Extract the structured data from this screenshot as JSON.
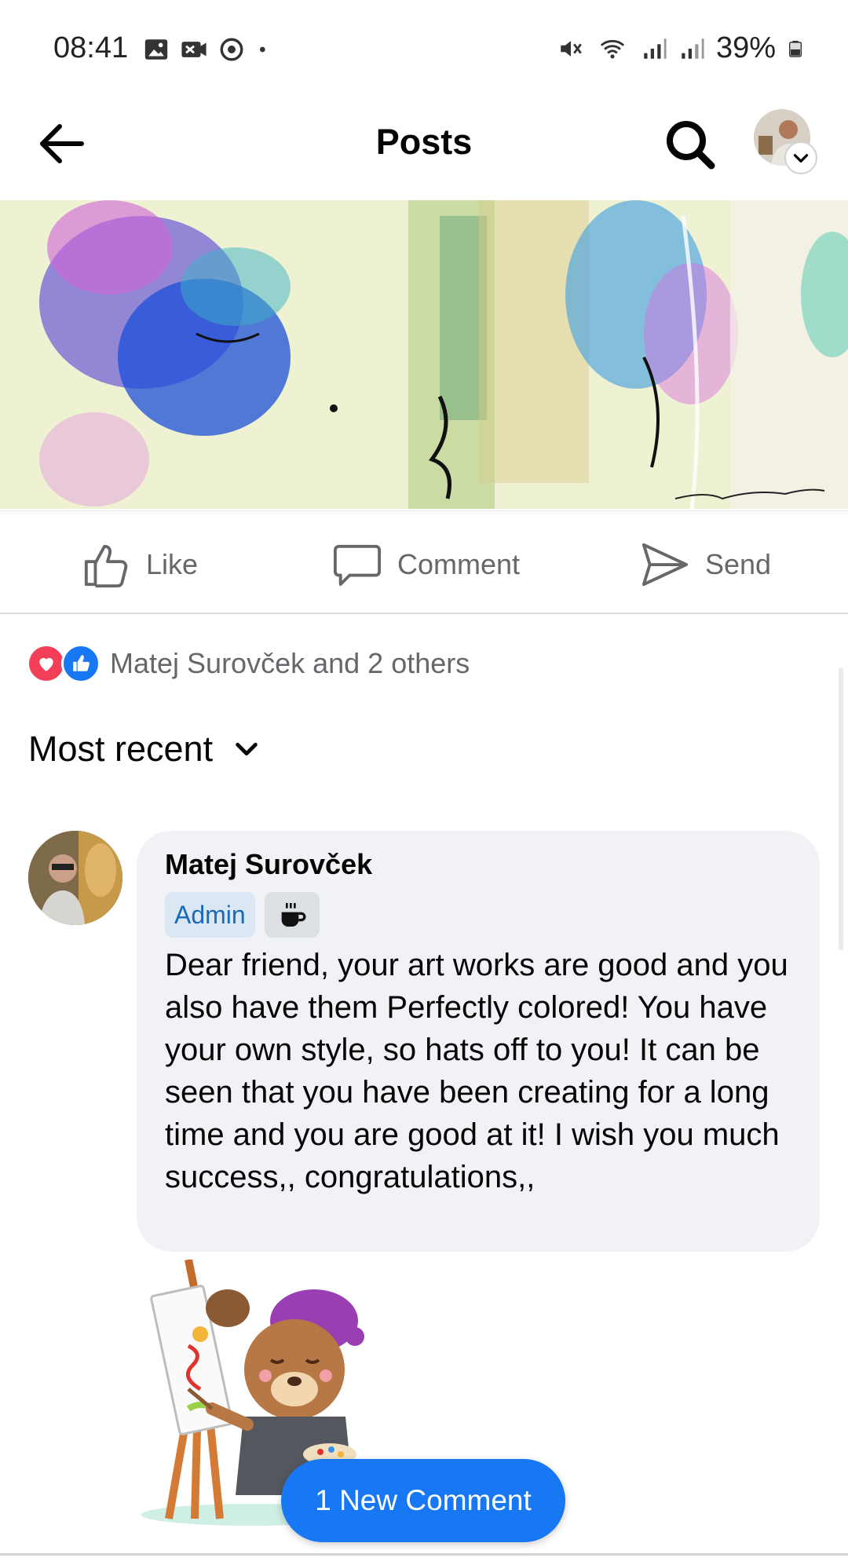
{
  "status_bar": {
    "time": "08:41",
    "battery_percent": "39%",
    "left_icons": [
      "gallery-icon",
      "media-icon",
      "sync-icon",
      "dot-icon"
    ],
    "right_icons": [
      "mute-icon",
      "wifi-icon",
      "signal-icon",
      "signal-icon",
      "battery-icon"
    ]
  },
  "header": {
    "title": "Posts"
  },
  "actions": {
    "like": "Like",
    "comment": "Comment",
    "send": "Send"
  },
  "reactions": {
    "text": "Matej Surovček and 2 others",
    "types": [
      "love",
      "like"
    ]
  },
  "sort": {
    "label": "Most recent"
  },
  "comment": {
    "author": "Matej Surovček",
    "badge": "Admin",
    "text": "Dear friend, your art works are good and you also have them Perfectly colored! You have your own style, so hats off to you!  It can be seen that you have been creating for a long time and you are good at it!  I wish you much success,, congratulations,,"
  },
  "new_comment_button": "1 New Comment",
  "colors": {
    "accent": "#1877f2",
    "love": "#f33e58",
    "bubble": "#f0f2f5",
    "secondary_text": "#65676b"
  }
}
